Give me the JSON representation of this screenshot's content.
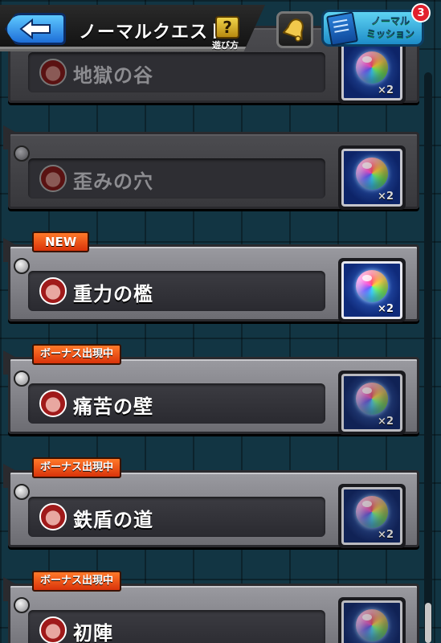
{
  "header": {
    "title": "ノーマルクエスト",
    "help_label": "遊び方",
    "help_glyph": "?",
    "mission_label_1": "ノーマル",
    "mission_label_2": "ミッション",
    "mission_badge": "3"
  },
  "colors": {
    "tag_orange": "#e8561a",
    "back_button_blue": "#2f8fe8",
    "mission_button_cyan": "#37b3e0",
    "badge_red": "#e21f2c"
  },
  "quests": [
    {
      "name": "地獄の谷",
      "tag": "",
      "reward_multiplier": "×2",
      "state": "cleared"
    },
    {
      "name": "歪みの穴",
      "tag": "",
      "reward_multiplier": "×2",
      "state": "cleared"
    },
    {
      "name": "重力の檻",
      "tag": "NEW",
      "reward_multiplier": "×2",
      "state": "new"
    },
    {
      "name": "痛苦の壁",
      "tag": "ボーナス出現中",
      "reward_multiplier": "×2",
      "state": "bonus"
    },
    {
      "name": "鉄盾の道",
      "tag": "ボーナス出現中",
      "reward_multiplier": "×2",
      "state": "bonus"
    },
    {
      "name": "初陣",
      "tag": "ボーナス出現中",
      "reward_multiplier": "",
      "state": "bonus"
    }
  ]
}
